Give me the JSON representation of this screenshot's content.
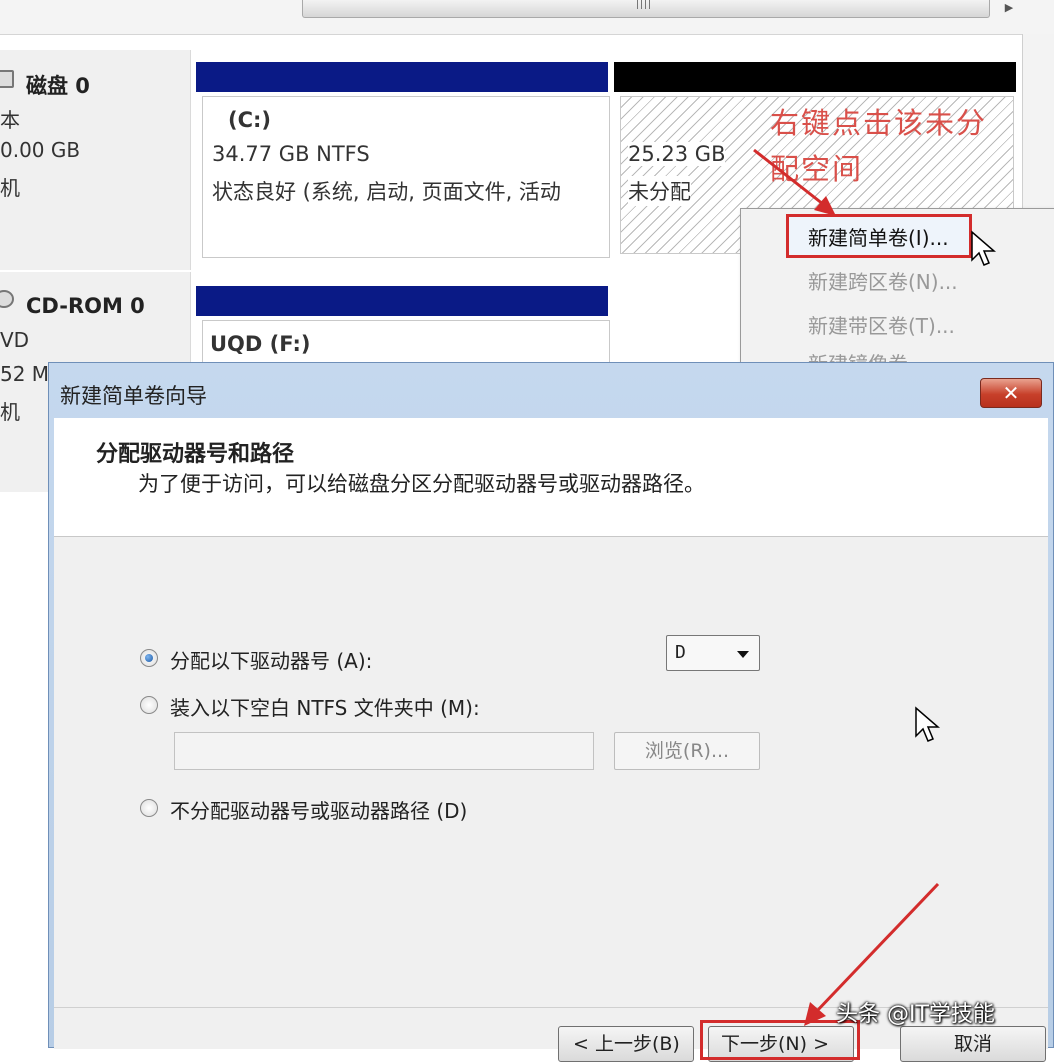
{
  "disk_mgmt": {
    "disk0": {
      "title": "磁盘 0",
      "line1": "本",
      "line2": "0.00 GB",
      "line3": "机"
    },
    "cdrom0": {
      "title": "CD-ROM 0",
      "line1": "VD",
      "line2": "52 M",
      "line3": "机"
    },
    "c_volume": {
      "name": "(C:)",
      "size": "34.77 GB NTFS",
      "status": "状态良好 (系统, 启动, 页面文件, 活动"
    },
    "unallocated": {
      "size": "25.23 GB",
      "label": "未分配"
    },
    "f_volume": {
      "name": "UQD   (F:)"
    }
  },
  "annotation": {
    "line1": "右键点击该未分",
    "line2": "配空间"
  },
  "context_menu": {
    "items": [
      {
        "label": "新建简单卷(I)...",
        "enabled": true
      },
      {
        "label": "新建跨区卷(N)...",
        "enabled": false
      },
      {
        "label": "新建带区卷(T)...",
        "enabled": false
      },
      {
        "label": "新建镜像卷...",
        "enabled": false
      }
    ]
  },
  "dialog": {
    "title": "新建简单卷向导",
    "close_label": "✕",
    "heading": "分配驱动器号和路径",
    "subheading": "为了便于访问，可以给磁盘分区分配驱动器号或驱动器路径。",
    "options": [
      {
        "label": "分配以下驱动器号 (A):",
        "selected": true
      },
      {
        "label": "装入以下空白 NTFS 文件夹中 (M):",
        "selected": false
      },
      {
        "label": "不分配驱动器号或驱动器路径 (D)",
        "selected": false
      }
    ],
    "drive_letter": "D",
    "folder_path": "",
    "browse_label": "浏览(R)...",
    "back_label": "< 上一步(B)",
    "next_label": "下一步(N) >",
    "cancel_label": "取消"
  },
  "watermark": "头条 @IT学技能",
  "colors": {
    "volume_bar": "#0a1a86",
    "unallocated_bar": "#000000",
    "annotation_red": "#d9504a",
    "highlight_red": "#d32c2c"
  }
}
